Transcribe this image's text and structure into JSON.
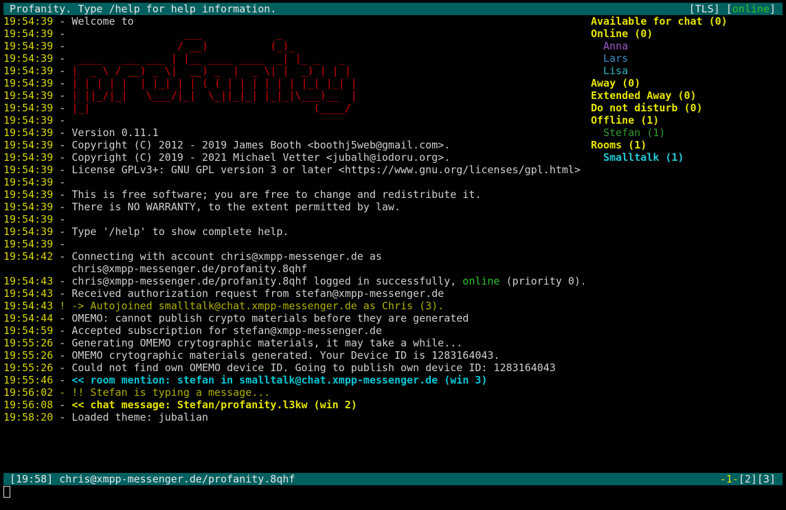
{
  "titlebar": {
    "title": "Profanity. Type /help for help information.",
    "tls_open": "[TLS] [",
    "presence": "online",
    "close_bracket": "]"
  },
  "messages": [
    {
      "ts": "19:54:39",
      "sep": " - ",
      "style": "txt",
      "text": "Welcome to"
    },
    {
      "ts": "19:54:39",
      "sep": " - ",
      "style": "logo",
      "text": "                  ___            _"
    },
    {
      "ts": "19:54:39",
      "sep": " - ",
      "style": "logo",
      "text": "                 / __)          (_)_"
    },
    {
      "ts": "19:54:39",
      "sep": " - ",
      "style": "logo",
      "text": " ____   ___ ___ | |__ ____ ____  _| |_ _   _"
    },
    {
      "ts": "19:54:39",
      "sep": " - ",
      "style": "logo",
      "text": "|  _ \\ / __) _ \\|  __) _  |  _ \\| |  _) | | |"
    },
    {
      "ts": "19:54:39",
      "sep": " - ",
      "style": "logo",
      "text": "| | | | |  | |_| | | ( ( | | | | | | |_| |_| |"
    },
    {
      "ts": "19:54:39",
      "sep": " - ",
      "style": "logo",
      "text": "| ||_/|_|   \\___/|_|  \\_||_|_| |_|_|\\___)__  |"
    },
    {
      "ts": "19:54:39",
      "sep": " - ",
      "style": "logo",
      "text": "|_|                                    (____/"
    },
    {
      "ts": "19:54:39",
      "sep": " - ",
      "style": "txt",
      "text": ""
    },
    {
      "ts": "19:54:39",
      "sep": " - ",
      "style": "txt",
      "text": "Version 0.11.1"
    },
    {
      "ts": "19:54:39",
      "sep": " - ",
      "style": "txt",
      "text": "Copyright (C) 2012 - 2019 James Booth <boothj5web@gmail.com>."
    },
    {
      "ts": "19:54:39",
      "sep": " - ",
      "style": "txt",
      "text": "Copyright (C) 2019 - 2021 Michael Vetter <jubalh@iodoru.org>."
    },
    {
      "ts": "19:54:39",
      "sep": " - ",
      "style": "txt",
      "text": "License GPLv3+: GNU GPL version 3 or later <https://www.gnu.org/licenses/gpl.html>"
    },
    {
      "ts": "19:54:39",
      "sep": " - ",
      "style": "txt",
      "text": ""
    },
    {
      "ts": "19:54:39",
      "sep": " - ",
      "style": "txt",
      "text": "This is free software; you are free to change and redistribute it."
    },
    {
      "ts": "19:54:39",
      "sep": " - ",
      "style": "txt",
      "text": "There is NO WARRANTY, to the extent permitted by law."
    },
    {
      "ts": "19:54:39",
      "sep": " - ",
      "style": "txt",
      "text": ""
    },
    {
      "ts": "19:54:39",
      "sep": " - ",
      "style": "txt",
      "text": "Type '/help' to show complete help."
    },
    {
      "ts": "19:54:39",
      "sep": " - ",
      "style": "txt",
      "text": ""
    },
    {
      "ts": "19:54:42",
      "sep": " - ",
      "style": "txt",
      "text": "Connecting with account chris@xmpp-messenger.de as"
    },
    {
      "ts": "",
      "sep": "",
      "style": "cont",
      "text": "chris@xmpp-messenger.de/profanity.8qhf"
    },
    {
      "ts": "19:54:43",
      "sep": " - ",
      "style": "login",
      "text": "chris@xmpp-messenger.de/profanity.8qhf logged in successfully, ",
      "presence": "online",
      "after": " (priority 0)."
    },
    {
      "ts": "19:54:43",
      "sep": " - ",
      "style": "txt",
      "text": "Received authorization request from stefan@xmpp-messenger.de"
    },
    {
      "ts": "19:54:43",
      "sep": " ! ",
      "style": "warn",
      "text": "-> Autojoined smalltalk@chat.xmpp-messenger.de as Chris (3)."
    },
    {
      "ts": "19:54:44",
      "sep": " - ",
      "style": "txt",
      "text": "OMEMO: cannot publish crypto materials before they are generated"
    },
    {
      "ts": "19:54:59",
      "sep": " - ",
      "style": "txt",
      "text": "Accepted subscription for stefan@xmpp-messenger.de"
    },
    {
      "ts": "19:55:26",
      "sep": " - ",
      "style": "txt",
      "text": "Generating OMEMO crytographic materials, it may take a while..."
    },
    {
      "ts": "19:55:26",
      "sep": " - ",
      "style": "txt",
      "text": "OMEMO crytographic materials generated. Your Device ID is 1283164043."
    },
    {
      "ts": "19:55:26",
      "sep": " - ",
      "style": "txt",
      "text": "Could not find own OMEMO device ID. Going to publish own device ID: 1283164043"
    },
    {
      "ts": "19:55:46",
      "sep": " - ",
      "style": "mention",
      "text": "<< room mention: stefan in smalltalk@chat.xmpp-messenger.de (win 3)"
    },
    {
      "ts": "19:56:02",
      "sep": " - ",
      "style": "warn",
      "text": "!! Stefan is typing a message..."
    },
    {
      "ts": "19:56:08",
      "sep": " - ",
      "style": "chatmsg",
      "text": "<< chat message: Stefan/profanity.l3kw (win 2)"
    },
    {
      "ts": "19:58:20",
      "sep": " - ",
      "style": "txt",
      "text": "Loaded theme: jubalian"
    }
  ],
  "roster": [
    {
      "kind": "hdr",
      "text": "Available for chat (0)"
    },
    {
      "kind": "hdr",
      "text": "Online (0)"
    },
    {
      "kind": "item",
      "cls": "c-anna",
      "text": "Anna"
    },
    {
      "kind": "item",
      "cls": "c-lars",
      "text": "Lars"
    },
    {
      "kind": "item",
      "cls": "c-lisa",
      "text": "Lisa"
    },
    {
      "kind": "hdr",
      "text": "Away (0)"
    },
    {
      "kind": "hdr",
      "text": "Extended Away (0)"
    },
    {
      "kind": "hdr",
      "text": "Do not disturb (0)"
    },
    {
      "kind": "hdr",
      "text": "Offline (1)"
    },
    {
      "kind": "item",
      "cls": "c-stefan",
      "text": "Stefan (1)"
    },
    {
      "kind": "hdr",
      "text": "Rooms (1)"
    },
    {
      "kind": "item",
      "cls": "c-room",
      "text": "Smalltalk (1)"
    }
  ],
  "statusbar": {
    "time": "[19:58]",
    "account": "chris@xmpp-messenger.de/profanity.8qhf",
    "win_active": "-1-",
    "win_2": "[2]",
    "win_3": "[3]"
  },
  "colors": {
    "bar_bg": "#005f5f",
    "timestamp": "#d7d700",
    "logo": "#d70000",
    "online": "#2ec42e"
  }
}
